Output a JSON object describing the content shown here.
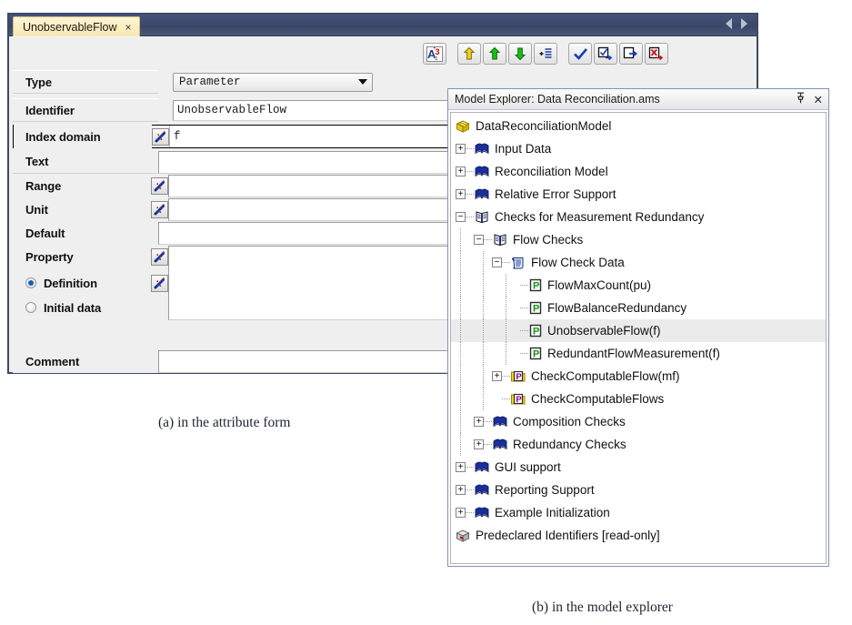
{
  "form_window": {
    "tab": {
      "label": "UnobservableFlow",
      "close": "×"
    },
    "nav": {
      "prev": "prev-page",
      "next": "next-page"
    },
    "toolbar": [
      {
        "name": "sort-az-button",
        "title": "A3 sort"
      },
      {
        "name": "move-up-level-button",
        "title": "yellow up arrow"
      },
      {
        "name": "move-up-button",
        "title": "green up arrow"
      },
      {
        "name": "move-down-button",
        "title": "green down arrow"
      },
      {
        "name": "indent-button",
        "title": "add to list"
      },
      {
        "name": "check-button",
        "title": "check"
      },
      {
        "name": "check-and-next-button",
        "title": "check and continue"
      },
      {
        "name": "page-next-button",
        "title": "commit and next"
      },
      {
        "name": "cancel-next-button",
        "title": "discard and next"
      }
    ],
    "rows": [
      {
        "label": "Type",
        "wizard": false,
        "control": "combo",
        "value": "Parameter"
      },
      {
        "label": "Identifier",
        "wizard": false,
        "control": "text",
        "value": "UnobservableFlow"
      },
      {
        "label": "Index domain",
        "wizard": true,
        "control": "text",
        "value": "f",
        "focused": true
      },
      {
        "label": "Text",
        "wizard": false,
        "control": "text",
        "value": ""
      },
      {
        "label": "Range",
        "wizard": true,
        "control": "text",
        "value": ""
      },
      {
        "label": "Unit",
        "wizard": true,
        "control": "text",
        "value": ""
      },
      {
        "label": "Default",
        "wizard": false,
        "control": "text",
        "value": ""
      },
      {
        "label": "Property",
        "wizard": true,
        "control": "text",
        "value": ""
      }
    ],
    "radios": [
      {
        "label": "Definition",
        "selected": true
      },
      {
        "label": "Initial data",
        "selected": false
      }
    ],
    "definition_value": "",
    "comment": {
      "label": "Comment",
      "value": ""
    }
  },
  "explorer": {
    "title": "Model Explorer: Data Reconciliation.ams",
    "pin_icon": "丬",
    "close_icon": "✕",
    "tree": [
      {
        "label": "DataReconciliationModel",
        "depth": 0,
        "icon": "model-box",
        "expander": "none"
      },
      {
        "label": "Input Data",
        "depth": 1,
        "icon": "book-closed",
        "expander": "plus"
      },
      {
        "label": "Reconciliation Model",
        "depth": 1,
        "icon": "book-closed",
        "expander": "plus"
      },
      {
        "label": "Relative Error Support",
        "depth": 1,
        "icon": "book-closed",
        "expander": "plus"
      },
      {
        "label": "Checks for Measurement Redundancy",
        "depth": 1,
        "icon": "book-open",
        "expander": "minus"
      },
      {
        "label": "Flow Checks",
        "depth": 2,
        "icon": "book-open",
        "expander": "minus"
      },
      {
        "label": "Flow Check Data",
        "depth": 3,
        "icon": "declaration",
        "expander": "minus"
      },
      {
        "label": "FlowMaxCount(pu)",
        "depth": 4,
        "icon": "parameter-p",
        "expander": "none"
      },
      {
        "label": "FlowBalanceRedundancy",
        "depth": 4,
        "icon": "parameter-p",
        "expander": "none"
      },
      {
        "label": "UnobservableFlow(f)",
        "depth": 4,
        "icon": "parameter-p",
        "expander": "none",
        "selected": true
      },
      {
        "label": "RedundantFlowMeasurement(f)",
        "depth": 4,
        "icon": "parameter-p",
        "expander": "none"
      },
      {
        "label": "CheckComputableFlow(mf)",
        "depth": 3,
        "icon": "procedure-p",
        "expander": "plus"
      },
      {
        "label": "CheckComputableFlows",
        "depth": 3,
        "icon": "procedure-p",
        "expander": "none"
      },
      {
        "label": "Composition Checks",
        "depth": 2,
        "icon": "book-closed",
        "expander": "plus"
      },
      {
        "label": "Redundancy Checks",
        "depth": 2,
        "icon": "book-closed",
        "expander": "plus"
      },
      {
        "label": "GUI support",
        "depth": 1,
        "icon": "book-closed",
        "expander": "plus"
      },
      {
        "label": "Reporting Support",
        "depth": 1,
        "icon": "book-closed",
        "expander": "plus"
      },
      {
        "label": "Example Initialization",
        "depth": 1,
        "icon": "book-closed",
        "expander": "plus"
      },
      {
        "label": "Predeclared Identifiers [read-only]",
        "depth": 0,
        "icon": "readonly-box",
        "expander": "none"
      }
    ]
  },
  "captions": {
    "a": "(a) in the attribute form",
    "b": "(b) in the model explorer"
  },
  "colors": {
    "titlebar": "#3b4767",
    "tab": "#fbeec0",
    "selection": "#ebebeb",
    "accent_blue": "#1560c0",
    "parameter_green": "#169216",
    "procedure_purple": "#8a008a"
  }
}
